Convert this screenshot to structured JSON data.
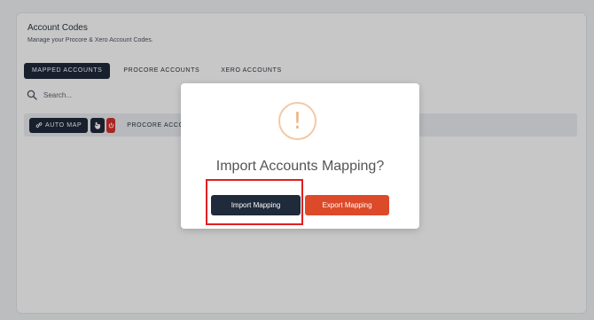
{
  "page": {
    "title": "Account Codes",
    "subtitle": "Manage your Procore & Xero Account Codes."
  },
  "tabs": [
    {
      "label": "MAPPED ACCOUNTS",
      "active": true
    },
    {
      "label": "PROCORE ACCOUNTS",
      "active": false
    },
    {
      "label": "XERO ACCOUNTS",
      "active": false
    }
  ],
  "search": {
    "placeholder": "Search..."
  },
  "toolbar": {
    "auto_map_label": "AUTO MAP",
    "column_header": "PROCORE ACCOUNT"
  },
  "modal": {
    "icon": "exclamation-icon",
    "icon_glyph": "!",
    "title": "Import Accounts Mapping?",
    "import_label": "Import Mapping",
    "export_label": "Export Mapping"
  },
  "colors": {
    "primary": "#1f2a3a",
    "danger": "#dc4a2a",
    "warning": "#f0b27e",
    "highlight": "#e02020"
  }
}
